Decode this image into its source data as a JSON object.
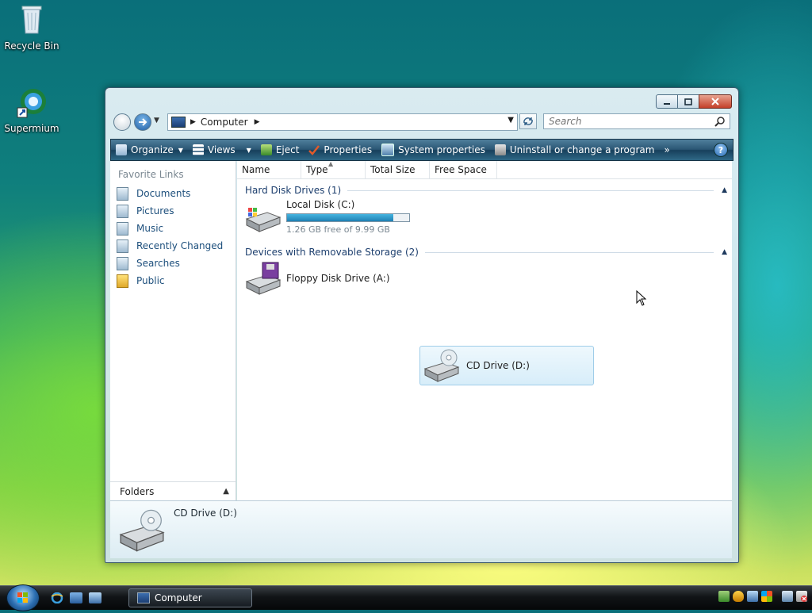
{
  "desktop": {
    "icons": [
      {
        "label": "Recycle Bin",
        "icon": "recycle-bin-icon"
      },
      {
        "label": "Supermium",
        "icon": "supermium-browser-icon"
      }
    ]
  },
  "window": {
    "address": {
      "crumb": "Computer"
    },
    "search": {
      "placeholder": "Search"
    },
    "commandbar": {
      "items": [
        {
          "label": "Organize",
          "icon": "organize-icon",
          "dropdown": true
        },
        {
          "label": "Views",
          "icon": "views-icon",
          "dropdown": true
        },
        {
          "label": "Eject",
          "icon": "eject-icon"
        },
        {
          "label": "Properties",
          "icon": "properties-icon"
        },
        {
          "label": "System properties",
          "icon": "system-properties-icon"
        },
        {
          "label": "Uninstall or change a program",
          "icon": "uninstall-icon"
        }
      ],
      "overflow": "»",
      "help": "?"
    },
    "navpane": {
      "header": "Favorite Links",
      "links": [
        {
          "label": "Documents",
          "icon": "documents-icon"
        },
        {
          "label": "Pictures",
          "icon": "pictures-icon"
        },
        {
          "label": "Music",
          "icon": "music-icon"
        },
        {
          "label": "Recently Changed",
          "icon": "recently-changed-icon"
        },
        {
          "label": "Searches",
          "icon": "searches-icon"
        },
        {
          "label": "Public",
          "icon": "public-folder-icon"
        }
      ],
      "folders_label": "Folders"
    },
    "content": {
      "columns": [
        "Name",
        "Type",
        "Total Size",
        "Free Space"
      ],
      "groups": [
        {
          "title": "Hard Disk Drives (1)",
          "items": [
            {
              "name": "Local Disk (C:)",
              "free_text": "1.26 GB free of 9.99 GB",
              "used_fraction": 0.87,
              "icon": "hard-disk-icon"
            }
          ]
        },
        {
          "title": "Devices with Removable Storage (2)",
          "items": [
            {
              "name": "Floppy Disk Drive (A:)",
              "icon": "floppy-drive-icon"
            },
            {
              "name": "CD Drive (D:)",
              "icon": "cd-drive-icon",
              "selected": true
            }
          ]
        }
      ]
    },
    "details": {
      "name": "CD Drive (D:)",
      "icon": "cd-drive-icon"
    }
  },
  "taskbar": {
    "active_task": "Computer",
    "tray_icons": [
      "network-icon",
      "security-shield-icon",
      "update-icon",
      "windows-flag-icon",
      "network-connection-icon",
      "volume-muted-icon"
    ]
  },
  "colors": {
    "accent": "#1d4f7c",
    "selection": "#d7edf9",
    "progress": "#1f7fb3"
  }
}
